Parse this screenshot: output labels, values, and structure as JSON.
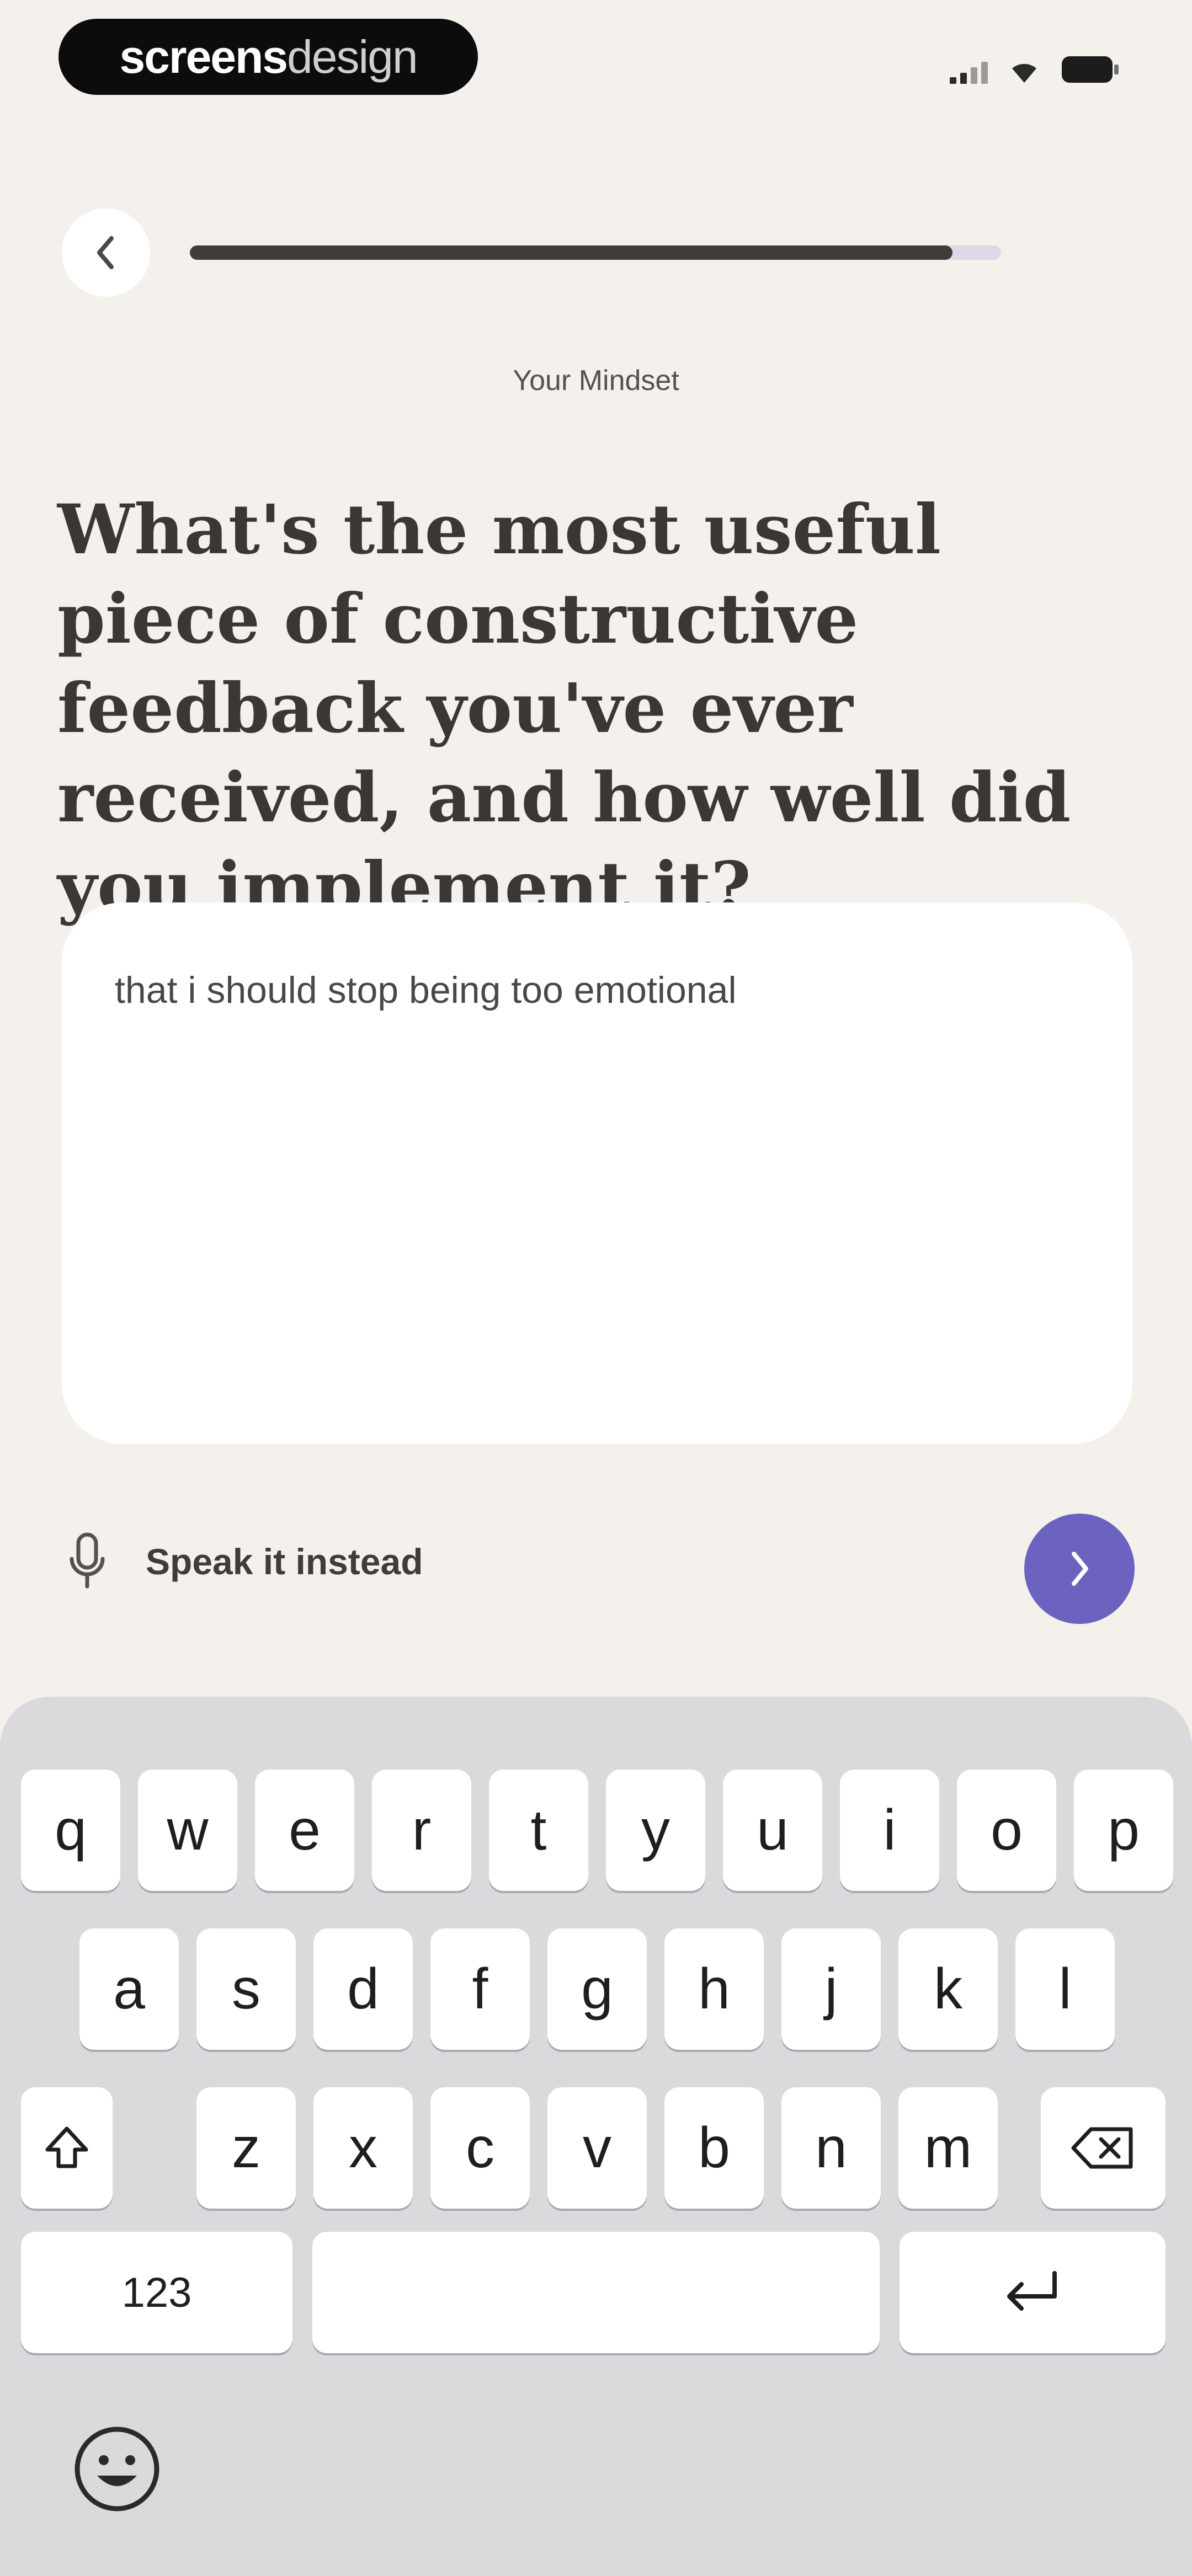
{
  "status_bar": {
    "watermark_bold": "screens",
    "watermark_light": "design"
  },
  "header": {
    "progress_percent": 94,
    "section_label": "Your Mindset"
  },
  "question": "What's the most useful piece of constructive feedback you've ever received, and how well did you implement it?",
  "answer": {
    "value": "that i should stop being too emotional"
  },
  "speak": {
    "label": "Speak it instead"
  },
  "colors": {
    "background": "#f4f1ec",
    "accent": "#6b63bf",
    "progress_fill": "#403c38",
    "progress_track": "#ddd8e8"
  },
  "keyboard": {
    "row1": [
      "q",
      "w",
      "e",
      "r",
      "t",
      "y",
      "u",
      "i",
      "o",
      "p"
    ],
    "row2": [
      "a",
      "s",
      "d",
      "f",
      "g",
      "h",
      "j",
      "k",
      "l"
    ],
    "row3": [
      "z",
      "x",
      "c",
      "v",
      "b",
      "n",
      "m"
    ],
    "numbers_label": "123",
    "icons": {
      "shift": "shift-icon",
      "backspace": "backspace-icon",
      "return": "return-icon",
      "emoji": "emoji-icon"
    }
  }
}
